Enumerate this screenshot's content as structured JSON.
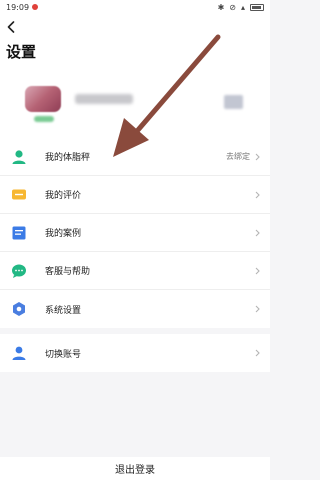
{
  "status_bar": {
    "time": "19:09"
  },
  "header": {
    "title": "设置"
  },
  "menu": {
    "items": [
      {
        "label": "我的体脂秤",
        "value": "去绑定"
      },
      {
        "label": "我的评价",
        "value": ""
      },
      {
        "label": "我的案例",
        "value": ""
      },
      {
        "label": "客服与帮助",
        "value": ""
      },
      {
        "label": "系统设置",
        "value": ""
      }
    ]
  },
  "account": {
    "switch_label": "切换账号"
  },
  "footer": {
    "logout_label": "退出登录"
  },
  "colors": {
    "accent_green": "#22b884",
    "arrow": "#8a4a3c",
    "background": "#f5f5f7"
  }
}
